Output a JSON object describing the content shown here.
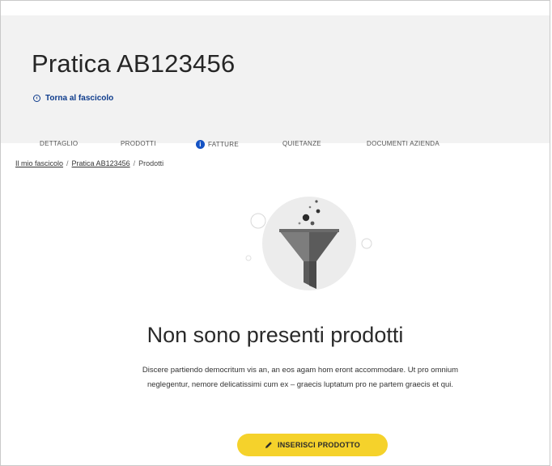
{
  "header": {
    "title": "Pratica AB123456",
    "back_link": "Torna al fascicolo"
  },
  "tabs": [
    {
      "label": "DETTAGLIO"
    },
    {
      "label": "PRODOTTI"
    },
    {
      "label": "FATTURE",
      "icon": "info-icon"
    },
    {
      "label": "QUIETANZE"
    },
    {
      "label": "DOCUMENTI AZIENDA"
    }
  ],
  "breadcrumb": {
    "item1": "Il mio fascicolo",
    "item2": "Pratica AB123456",
    "current": "Prodotti",
    "separator": "/"
  },
  "empty_state": {
    "icon": "funnel-icon",
    "title": "Non sono presenti prodotti",
    "description": "Discere partiendo democritum vis an, an eos agam hom eront accommodare. Ut pro omnium neglegentur, nemore delicatissimi cum ex – graecis luptatum pro ne partem graecis et qui.",
    "cta_label": "INSERISCI PRODOTTO",
    "cta_icon": "pencil-icon"
  },
  "colors": {
    "header_bg": "#f2f2f2",
    "link_blue": "#0d3b8c",
    "info_blue": "#1553c4",
    "cta_yellow": "#f5d22b"
  }
}
